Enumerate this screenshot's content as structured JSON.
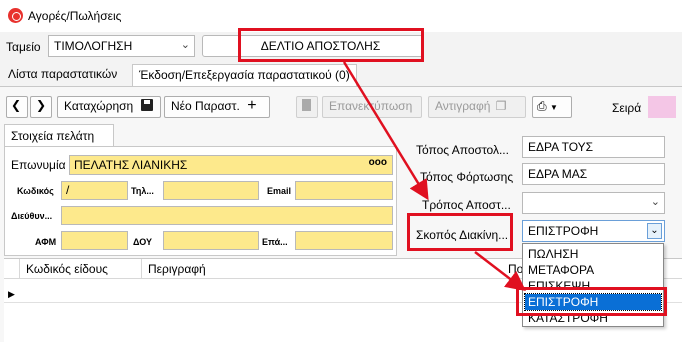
{
  "window": {
    "title": "Αγορές/Πωλήσεις"
  },
  "header": {
    "cashier_label": "Ταμείο",
    "cashier_value": "ΤΙΜΟΛΟΓΗΣΗ",
    "doc_type": "ΔΕΛΤΙΟ ΑΠΟΣΤΟΛΗΣ"
  },
  "tabs": [
    {
      "label": "Λίστα παραστατικών"
    },
    {
      "label": "Έκδοση/Επεξεργασία παραστατικού (0)"
    }
  ],
  "toolbar": {
    "save_label": "Καταχώρηση",
    "new_label": "Νέο Παραστ.",
    "restore_label": "Επανεκτύπωση",
    "copy_label": "Αντιγραφή",
    "series_label": "Σειρά"
  },
  "customer": {
    "tab_label": "Στοιχεία πελάτη",
    "name_label": "Επωνυμία",
    "name_value": "ΠΕΛΑΤΗΣ ΛΙΑΝΙΚΗΣ",
    "more_label": "ooo",
    "code_label": "Κωδικός",
    "code_value": "/",
    "phone_label": "Τηλ...",
    "email_label": "Email",
    "address_label": "Διεύθυν...",
    "afm_label": "ΑΦΜ",
    "doy_label": "ΔΟΥ",
    "occupation_label": "Επά..."
  },
  "shipping": {
    "destination_label": "Τόπος Αποστολ...",
    "destination_value": "ΕΔΡΑ ΤΟΥΣ",
    "loading_label": "Τόπος Φόρτωσης",
    "loading_value": "ΕΔΡΑ ΜΑΣ",
    "method_label": "Τρόπος Αποστ...",
    "method_value": "",
    "purpose_label": "Σκοπός Διακίνη...",
    "purpose_value": "ΕΠΙΣΤΡΟΦΗ"
  },
  "purpose_options": [
    "ΠΩΛΗΣΗ",
    "ΜΕΤΑΦΟΡΑ",
    "ΕΠΙΣΚΕΨΗ",
    "ΕΠΙΣΤΡΟΦΗ",
    "ΚΑΤΑΣΤΡΟΦΗ"
  ],
  "grid": {
    "columns": [
      "Κωδικός είδους",
      "Περιγραφή",
      "Πο"
    ]
  },
  "colors": {
    "annotation": "#e01020",
    "selection": "#0a6fd6",
    "customer_fields": "#fde98c",
    "series_swatch": "#f4c6e6"
  }
}
